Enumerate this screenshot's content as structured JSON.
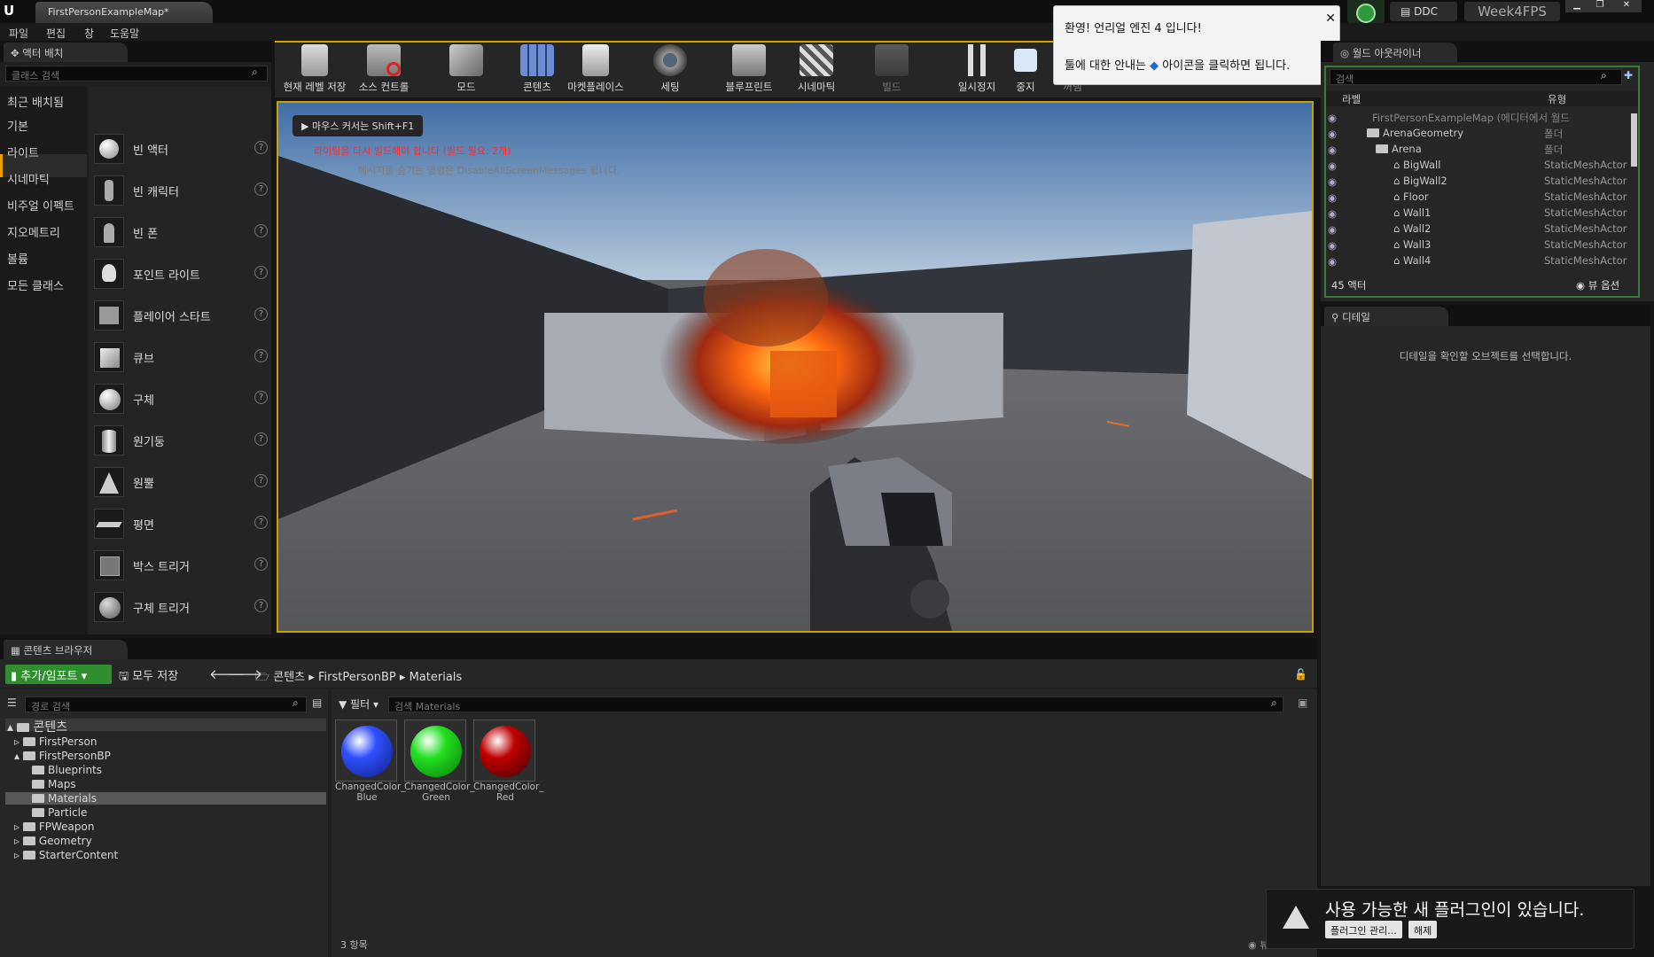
{
  "app": {
    "tab_title": "FirstPersonExampleMap*",
    "project_name": "Week4FPS",
    "ddc_label": "DDC"
  },
  "menu": [
    "파일",
    "편집",
    "창",
    "도움말"
  ],
  "place_actors": {
    "tab_title": "액터 배치",
    "search_placeholder": "클래스 검색",
    "categories": [
      "최근 배치됨",
      "기본",
      "라이트",
      "시네마틱",
      "비주얼 이펙트",
      "지오메트리",
      "볼륨",
      "모든 클래스"
    ],
    "items": [
      "빈 액터",
      "빈 캐릭터",
      "빈 폰",
      "포인트 라이트",
      "플레이어 스타트",
      "큐브",
      "구체",
      "원기둥",
      "원뿔",
      "평면",
      "박스 트리거",
      "구체 트리거"
    ],
    "help_glyph": "?"
  },
  "toolbar": [
    "현재 레벨 저장",
    "소스 컨트롤",
    "모드",
    "콘텐츠",
    "마켓플레이스",
    "세팅",
    "블루프린트",
    "시네마틱",
    "빌드",
    "일시정지",
    "중지",
    "꺼냄"
  ],
  "viewport": {
    "hint": "마우스 커서는 Shift+F1",
    "msg_error": "라이팅을 다시 빌드해야 합니다 (빌드 필요: 2개)",
    "msg_info": "메시지를 숨기는 명령은 DisableAllScreenMessages 입니다."
  },
  "welcome": {
    "title": "환영! 언리얼 엔진 4 입니다!",
    "body_a": "툴에 대한 안내는",
    "body_b": "아이콘을 클릭하면 됩니다.",
    "close": "✕"
  },
  "outliner": {
    "tab_title": "월드 아웃라이너",
    "search_placeholder": "검색",
    "col_label": "라벨",
    "col_type": "유형",
    "rows": [
      {
        "label": "FirstPersonExampleMap (에디터에서 월드",
        "type": ""
      },
      {
        "label": "ArenaGeometry",
        "type": "폴더"
      },
      {
        "label": "Arena",
        "type": "폴더"
      },
      {
        "label": "BigWall",
        "type": "StaticMeshActor"
      },
      {
        "label": "BigWall2",
        "type": "StaticMeshActor"
      },
      {
        "label": "Floor",
        "type": "StaticMeshActor"
      },
      {
        "label": "Wall1",
        "type": "StaticMeshActor"
      },
      {
        "label": "Wall2",
        "type": "StaticMeshActor"
      },
      {
        "label": "Wall3",
        "type": "StaticMeshActor"
      },
      {
        "label": "Wall4",
        "type": "StaticMeshActor"
      }
    ],
    "count": "45 액터",
    "view_options": "뷰 옵션"
  },
  "details": {
    "tab_title": "디테일",
    "empty_msg": "디테일을 확인할 오브젝트를 선택합니다."
  },
  "content_browser": {
    "tab_title": "콘텐츠 브라우저",
    "add_import": "추가/임포트",
    "save_all": "모두 저장",
    "breadcrumb": [
      "콘텐츠",
      "FirstPersonBP",
      "Materials"
    ],
    "path_search_placeholder": "경로 검색",
    "filter_label": "필터",
    "asset_search_placeholder": "검색 Materials",
    "tree": [
      {
        "label": "콘텐츠",
        "level": 0
      },
      {
        "label": "FirstPerson",
        "level": 1
      },
      {
        "label": "FirstPersonBP",
        "level": 1
      },
      {
        "label": "Blueprints",
        "level": 2
      },
      {
        "label": "Maps",
        "level": 2
      },
      {
        "label": "Materials",
        "level": 2
      },
      {
        "label": "Particle",
        "level": 2
      },
      {
        "label": "FPWeapon",
        "level": 1
      },
      {
        "label": "Geometry",
        "level": 1
      },
      {
        "label": "StarterContent",
        "level": 1
      }
    ],
    "assets": [
      {
        "name_l1": "ChangedColor_",
        "name_l2": "Blue",
        "color": "#2f4fff"
      },
      {
        "name_l1": "ChangedColor_",
        "name_l2": "Green",
        "color": "#22e022"
      },
      {
        "name_l1": "ChangedColor_",
        "name_l2": "Red",
        "color": "#c00000"
      }
    ],
    "count": "3 항목",
    "view_options": "뷰 옵션"
  },
  "plugin_notice": {
    "text": "사용 가능한 새 플러그인이 있습니다.",
    "manage": "플러그인 관리...",
    "dismiss": "해제"
  }
}
